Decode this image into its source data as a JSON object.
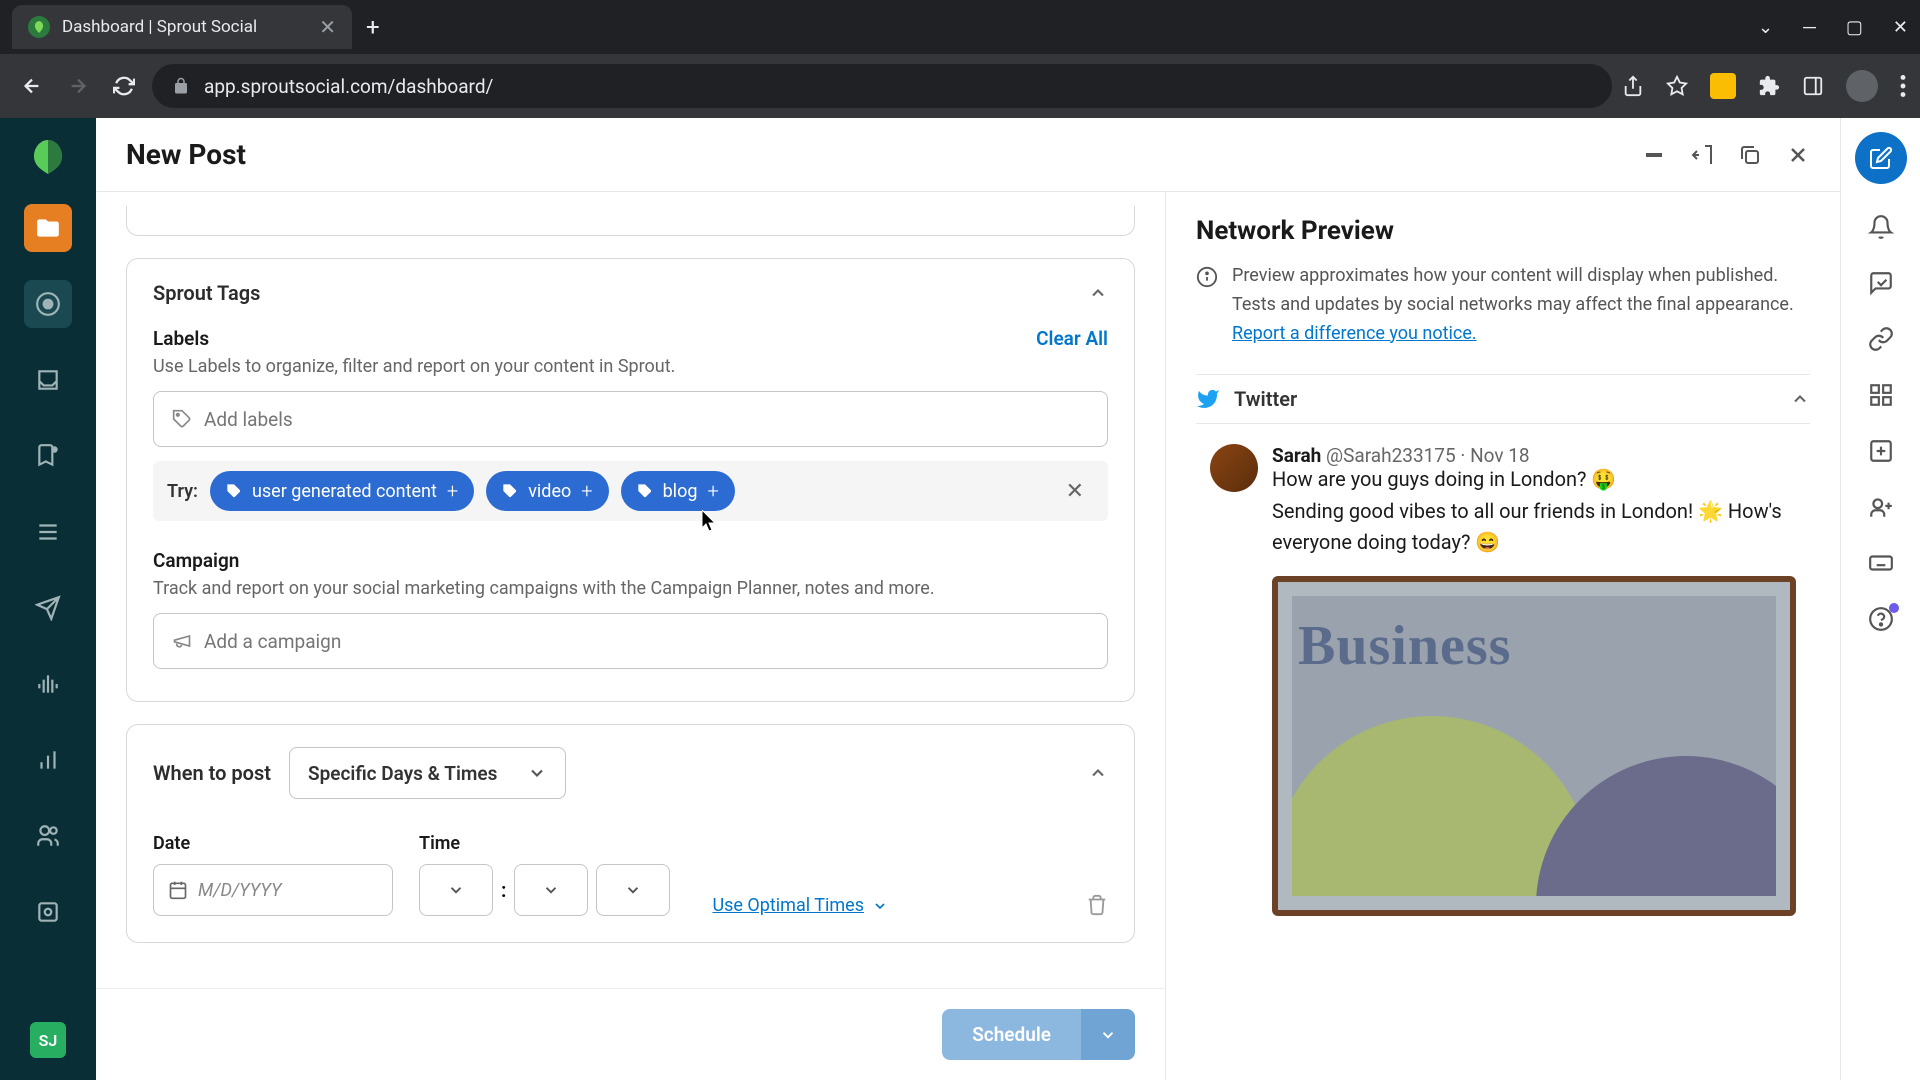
{
  "browser": {
    "tab_title": "Dashboard | Sprout Social",
    "url": "app.sproutsocial.com/dashboard/"
  },
  "header": {
    "title": "New Post"
  },
  "sprout_tags": {
    "section_title": "Sprout Tags",
    "labels": {
      "title": "Labels",
      "clear_all": "Clear All",
      "hint": "Use Labels to organize, filter and report on your content in Sprout.",
      "placeholder": "Add labels",
      "try_label": "Try:",
      "suggestions": [
        {
          "text": "user generated content"
        },
        {
          "text": "video"
        },
        {
          "text": "blog"
        }
      ]
    },
    "campaign": {
      "title": "Campaign",
      "hint": "Track and report on your social marketing campaigns with the Campaign Planner, notes and more.",
      "placeholder": "Add a campaign"
    }
  },
  "schedule": {
    "section_title": "When to post",
    "dropdown_value": "Specific Days & Times",
    "date_label": "Date",
    "date_placeholder": "M/D/YYYY",
    "time_label": "Time",
    "optimal_link": "Use Optimal Times"
  },
  "footer": {
    "schedule_button": "Schedule"
  },
  "preview": {
    "title": "Network Preview",
    "info_text": "Preview approximates how your content will display when published. Tests and updates by social networks may affect the final appearance. ",
    "report_link": "Report a difference you notice.",
    "network_name": "Twitter",
    "tweet": {
      "name": "Sarah",
      "handle": "@Sarah233175",
      "date": "Nov 18",
      "line1": "How are you guys doing in London? 🤑",
      "line2": "Sending good vibes to all our friends in London! 🌟 How's everyone doing today? 😄",
      "img_text": "Business"
    }
  },
  "left_rail_badge": "SJ"
}
